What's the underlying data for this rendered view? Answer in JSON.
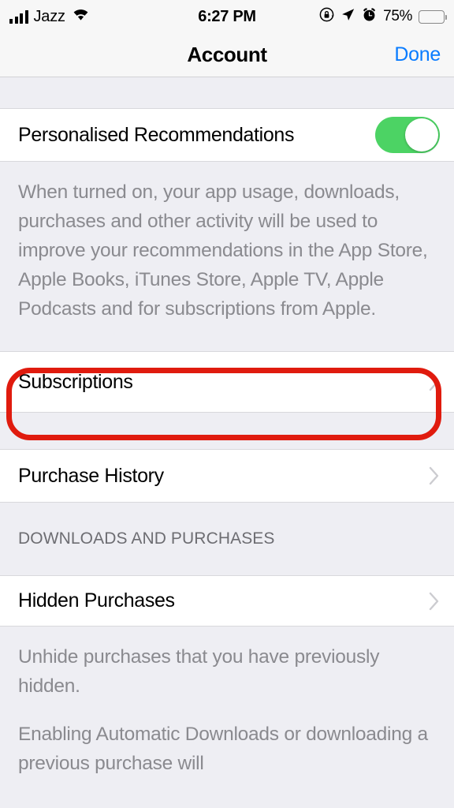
{
  "status_bar": {
    "carrier": "Jazz",
    "time": "6:27 PM",
    "battery_percent": "75%",
    "icons": {
      "signal": "cellular-signal-icon",
      "wifi": "wifi-icon",
      "rotation_lock": "rotation-lock-icon",
      "location": "location-arrow-icon",
      "alarm": "alarm-clock-icon",
      "battery": "battery-icon"
    }
  },
  "nav_bar": {
    "title": "Account",
    "done_label": "Done"
  },
  "content": {
    "personalised_row": {
      "label": "Personalised Recommendations",
      "toggle_state": "on"
    },
    "personalised_footer": "When turned on, your app usage, downloads, purchases and other activity will be used to improve your recommendations in the App Store, Apple Books, iTunes Store, Apple TV, Apple Podcasts and for subscriptions from Apple.",
    "subscriptions_row": {
      "label": "Subscriptions",
      "highlighted": true
    },
    "purchase_history_row": {
      "label": "Purchase History"
    },
    "downloads_section_header": "DOWNLOADS AND PURCHASES",
    "hidden_purchases_row": {
      "label": "Hidden Purchases"
    },
    "hidden_purchases_footer": "Unhide purchases that you have previously hidden.",
    "automatic_downloads_footer": "Enabling Automatic Downloads or downloading a previous purchase will"
  },
  "colors": {
    "accent_blue": "#0A7CFF",
    "toggle_green": "#4CD364",
    "annotation_red": "#E01B0E",
    "table_background": "#EEEEF3",
    "cell_background": "#FFFFFF",
    "secondary_text": "#8A8A8F",
    "header_text": "#6D6D72"
  }
}
